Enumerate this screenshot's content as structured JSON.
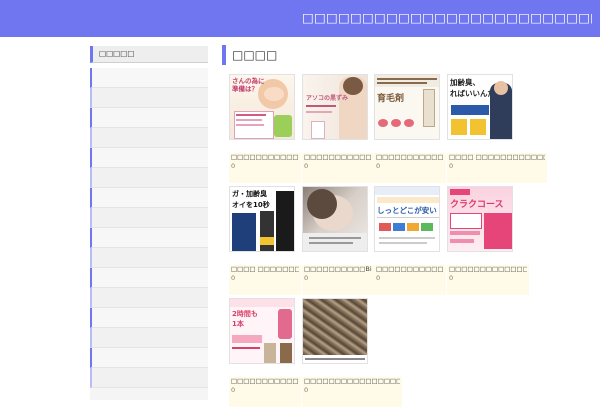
{
  "header": {
    "site_title": "□□□□□□□□□□□□□□□□□□□□□□□□□□□□□□□"
  },
  "sidebar": {
    "heading": "□□□□□"
  },
  "main": {
    "heading": "□□□□",
    "cards": [
      {
        "thumb_text": "さんの為に\n準備は？",
        "caption": "□□□□□□□□□□□□□□□□□□□□□□□□□□□□□□□□□□",
        "count": "0"
      },
      {
        "thumb_text": "アソコの黒ずみ",
        "caption": "□□□□□□□□□□□□□□□□□□□□□□□□□□□□□□□□□□",
        "count": "0"
      },
      {
        "thumb_text": "育毛剤",
        "caption": "□□□□□□□□□□□□□□ □□□□□□□□ □□□□□",
        "count": "0"
      },
      {
        "thumb_text": "加齢臭、\nればいいんだ?",
        "caption": "□□□□ □□□□□□□□□□□□□□□□□□□□□□□□□□□",
        "count": "0"
      },
      {
        "thumb_text": "ガ・加齢臭\nオイを10秒",
        "caption": "□□□□ □□□□□□□□□□□□□□□□□□□□□□□□□□□",
        "count": "0"
      },
      {
        "thumb_text": "",
        "caption": "□□□□□□□□□□Bimoon□□□□□□□□□□□",
        "count": "0"
      },
      {
        "thumb_text": "しっとどこが安い",
        "caption": "□□□□□□□□□□□□□□□□□□□□□□□□□□□□□□□□",
        "count": "0"
      },
      {
        "thumb_text": "クラクコース",
        "caption": "□□□□□□□□□□□□□□□□□□□□□□□□□□□□□□□□□",
        "count": "0"
      },
      {
        "thumb_text": "2時間も\n1本",
        "caption": "□□□□□□□□□□□□□□□□□□□□□□□□□□□□□□□□□□",
        "count": "0"
      },
      {
        "thumb_text": "",
        "caption": "□□□□□□□□□□□□□□□□□□□□□□□□□□□□□□□",
        "count": "0"
      }
    ]
  }
}
